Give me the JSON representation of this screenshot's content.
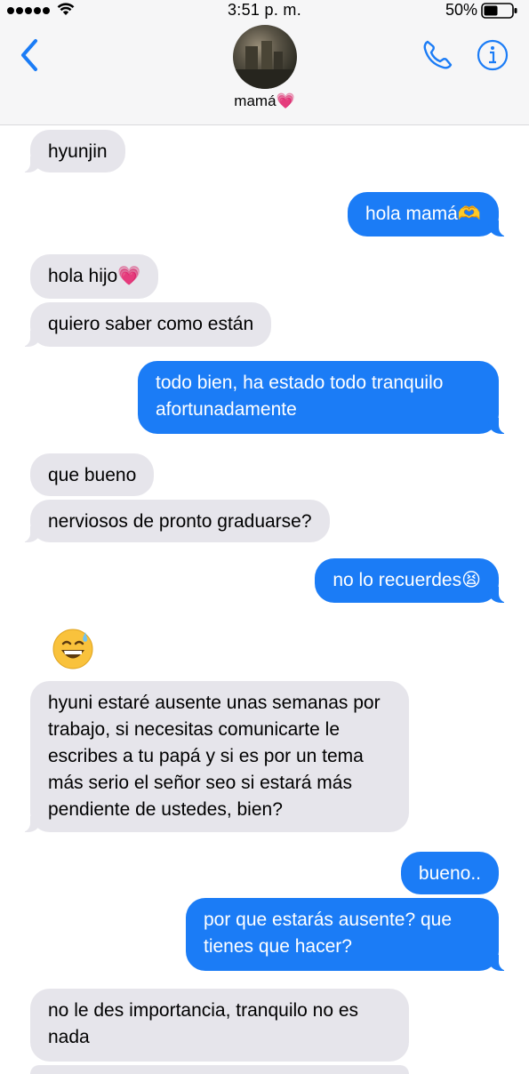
{
  "status_bar": {
    "time": "3:51 p. m.",
    "battery_percent": "50%",
    "battery_level": 0.5,
    "signal_bars": 5
  },
  "contact": {
    "name": "mamá💗"
  },
  "icons": [
    "back-chevron-icon",
    "phone-icon",
    "info-icon",
    "wifi-icon",
    "battery-icon",
    "grinning-sweat-emoji"
  ],
  "colors": {
    "outgoing": "#1b7cf6",
    "incoming": "#e6e5eb",
    "accent": "#1b7cf6"
  },
  "messages": [
    {
      "from": "them",
      "text": "hyunjin"
    },
    {
      "from": "me",
      "text": "hola mamá🫶"
    },
    {
      "from": "them",
      "text": "hola hijo💗"
    },
    {
      "from": "them",
      "text": "quiero saber como están"
    },
    {
      "from": "me",
      "text": "todo bien, ha estado todo tranquilo afortunadamente"
    },
    {
      "from": "them",
      "text": "que bueno"
    },
    {
      "from": "them",
      "text": "nerviosos de pronto graduarse?"
    },
    {
      "from": "me",
      "text": "no lo recuerdes😫"
    },
    {
      "from": "them",
      "text": "😅"
    },
    {
      "from": "them",
      "text": "hyuni estaré ausente unas semanas por trabajo, si necesitas comunicarte le escribes a tu papá y si es por un tema más serio el señor seo si estará más pendiente de ustedes, bien?"
    },
    {
      "from": "me",
      "text": "bueno.."
    },
    {
      "from": "me",
      "text": "por que estarás ausente? que tienes que hacer?"
    },
    {
      "from": "them",
      "text": "no le des importancia, tranquilo no es nada"
    }
  ]
}
